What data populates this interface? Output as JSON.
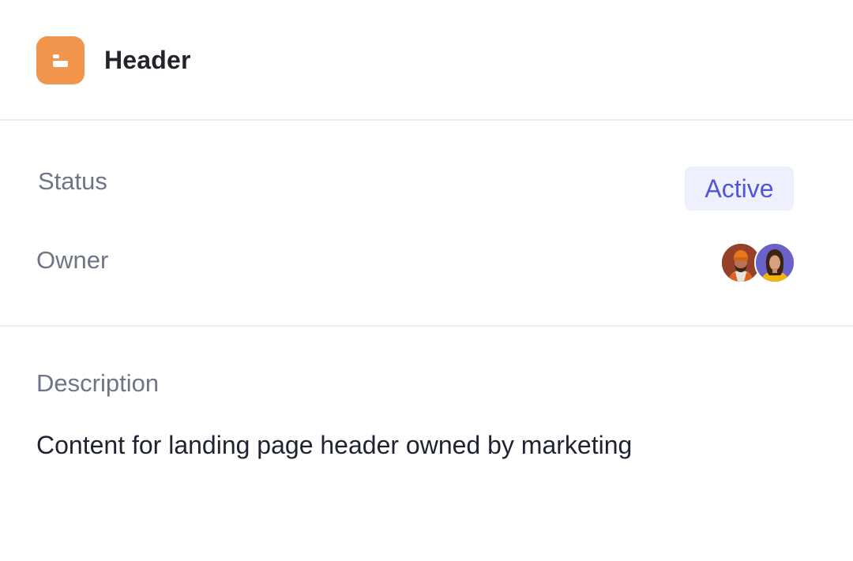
{
  "header": {
    "title": "Header",
    "icon": "header-layout-icon",
    "icon_color": "#f0954b"
  },
  "properties": {
    "status_label": "Status",
    "status_value": "Active",
    "status_color": "#5057d6",
    "status_bg": "#eef0fd",
    "owner_label": "Owner",
    "owners": [
      {
        "avatar": "man-with-orange-beanie"
      },
      {
        "avatar": "woman-in-yellow-top"
      }
    ]
  },
  "description": {
    "label": "Description",
    "text": "Content for landing page header owned by marketing"
  }
}
